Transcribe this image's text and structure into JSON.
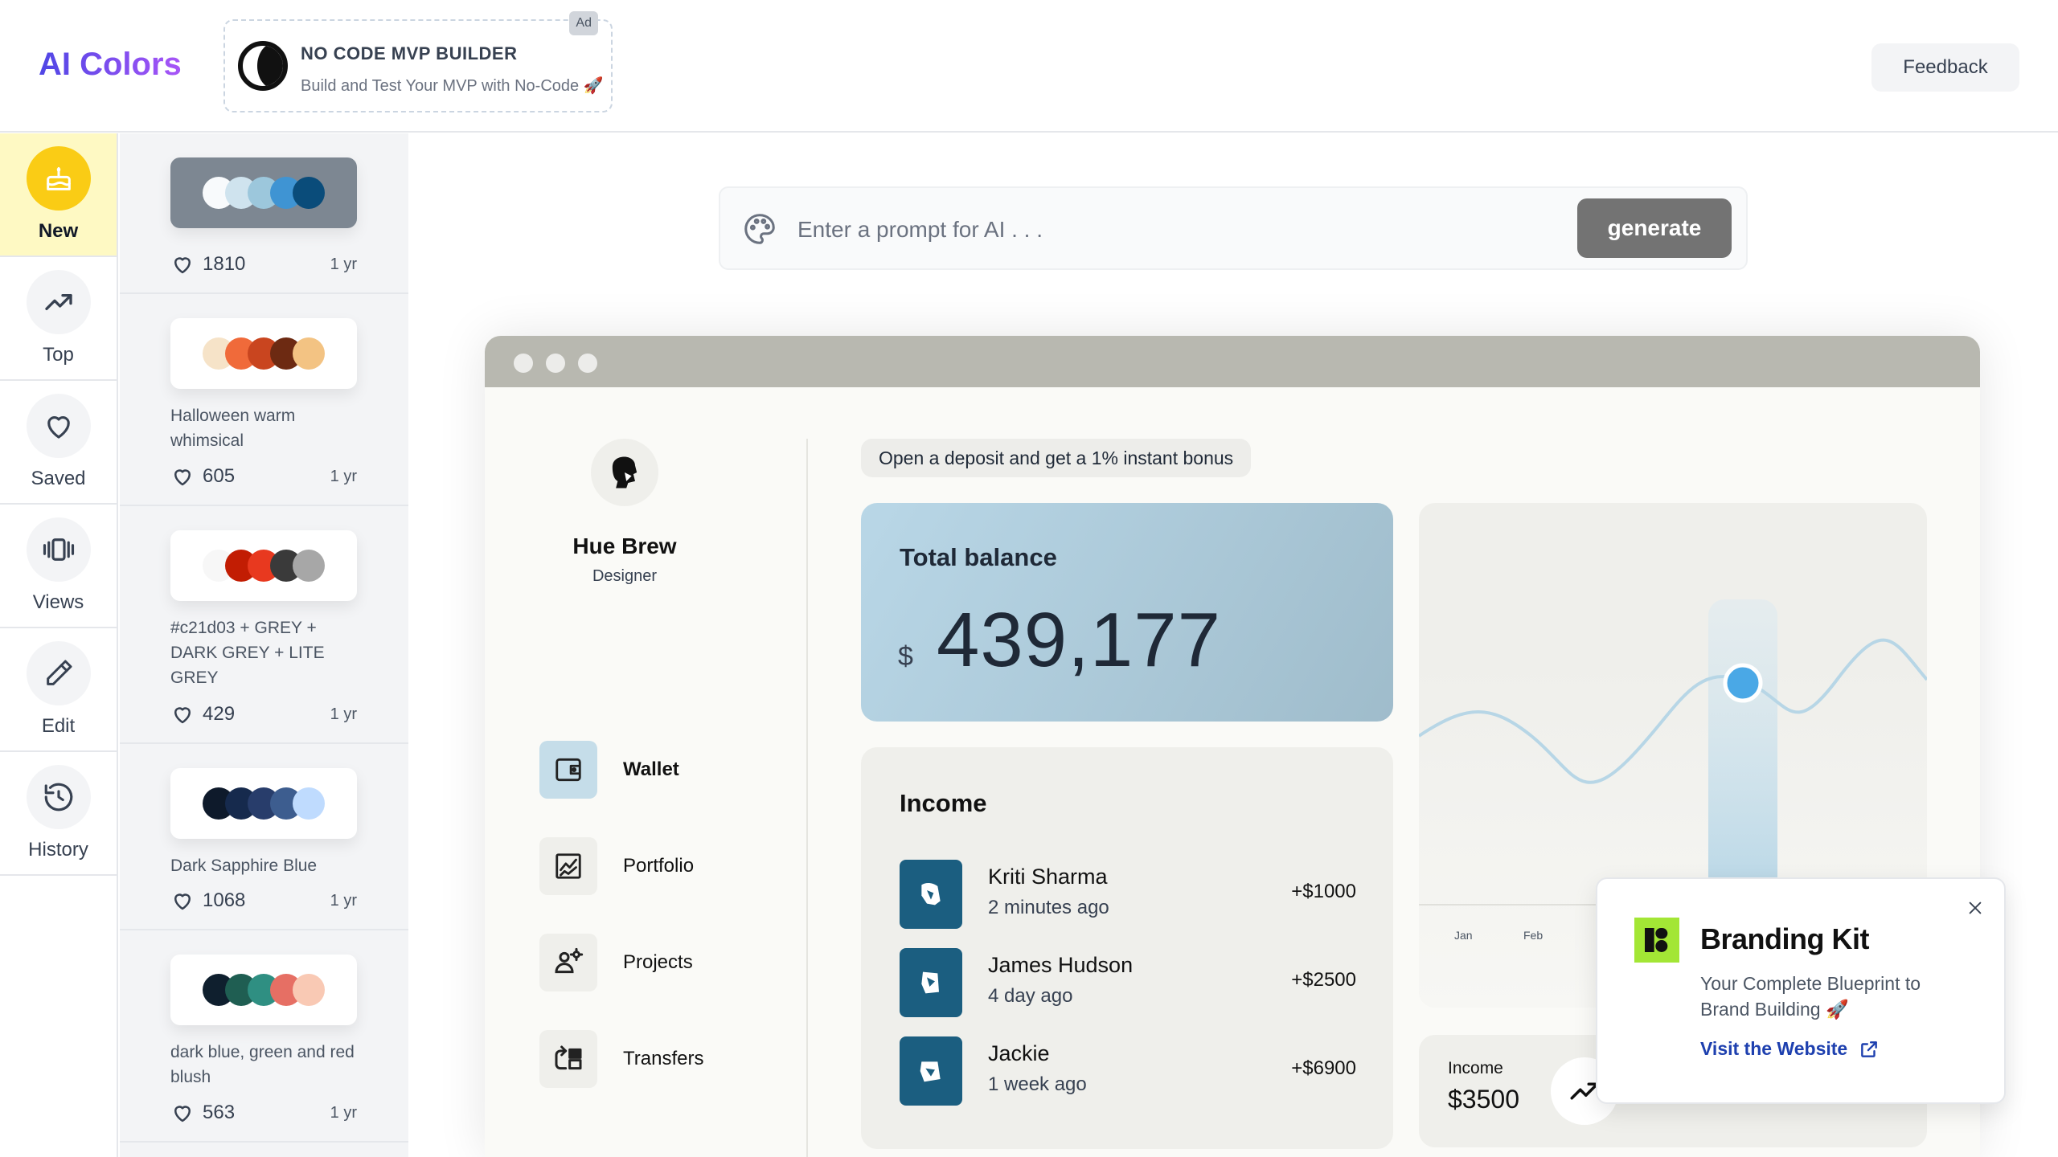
{
  "header": {
    "logo": "AI Colors",
    "ad": {
      "badge": "Ad",
      "title": "NO CODE MVP BUILDER",
      "subtitle": "Build and Test Your MVP with No-Code 🚀"
    },
    "feedback_label": "Feedback"
  },
  "nav": {
    "items": [
      {
        "label": "New",
        "icon": "cake-icon",
        "active": true
      },
      {
        "label": "Top",
        "icon": "trending-up-icon"
      },
      {
        "label": "Saved",
        "icon": "heart-icon"
      },
      {
        "label": "Views",
        "icon": "carousel-icon"
      },
      {
        "label": "Edit",
        "icon": "pencil-icon"
      },
      {
        "label": "History",
        "icon": "history-icon"
      }
    ]
  },
  "palettes": [
    {
      "title": "",
      "likes": "1810",
      "age": "1 yr",
      "colors": [
        "#f8fafc",
        "#cfe3ee",
        "#9cc7dc",
        "#3f94d3",
        "#0a4c7a"
      ],
      "card_bg": "#7d8792"
    },
    {
      "title": "Halloween warm whimsical",
      "likes": "605",
      "age": "1 yr",
      "colors": [
        "#f6e3c8",
        "#f06a3a",
        "#c9451f",
        "#6d2a12",
        "#f3c383"
      ],
      "card_bg": "#ffffff"
    },
    {
      "title": "#c21d03 + GREY + DARK GREY + LITE GREY",
      "likes": "429",
      "age": "1 yr",
      "colors": [
        "#f7f7f7",
        "#c21d03",
        "#e8391f",
        "#3a3a3a",
        "#a7a7a7"
      ],
      "card_bg": "#ffffff"
    },
    {
      "title": "Dark Sapphire Blue",
      "likes": "1068",
      "age": "1 yr",
      "colors": [
        "#0e1a2b",
        "#162a4d",
        "#283d6b",
        "#3d5d8f",
        "#bfdbfe"
      ],
      "card_bg": "#ffffff"
    },
    {
      "title": "dark blue, green and red blush",
      "likes": "563",
      "age": "1 yr",
      "colors": [
        "#0f1f2e",
        "#1f5e52",
        "#2f8f82",
        "#e66f64",
        "#f9c9b4"
      ],
      "card_bg": "#ffffff"
    }
  ],
  "prompt": {
    "placeholder": "Enter a prompt for AI . . .",
    "button": "generate"
  },
  "preview": {
    "profile": {
      "name": "Hue Brew",
      "role": "Designer"
    },
    "menu": [
      {
        "label": "Wallet",
        "icon": "wallet-icon",
        "active": true
      },
      {
        "label": "Portfolio",
        "icon": "chart-icon"
      },
      {
        "label": "Projects",
        "icon": "team-icon"
      },
      {
        "label": "Transfers",
        "icon": "transfer-icon"
      }
    ],
    "promo": "Open a deposit and get a 1% instant bonus",
    "balance": {
      "title": "Total balance",
      "currency": "$",
      "value": "439,177"
    },
    "income": {
      "title": "Income",
      "transactions": [
        {
          "name": "Kriti Sharma",
          "time": "2 minutes ago",
          "amount": "+$1000"
        },
        {
          "name": "James Hudson",
          "time": "4 day ago",
          "amount": "+$2500"
        },
        {
          "name": "Jackie",
          "time": "1 week ago",
          "amount": "+$6900"
        }
      ]
    },
    "chart": {
      "months": [
        "Jan",
        "Feb"
      ]
    },
    "mini": {
      "label": "Income",
      "value": "$3500"
    }
  },
  "popup": {
    "title": "Branding Kit",
    "description": "Your Complete Blueprint to Brand Building 🚀",
    "link": "Visit the Website"
  }
}
